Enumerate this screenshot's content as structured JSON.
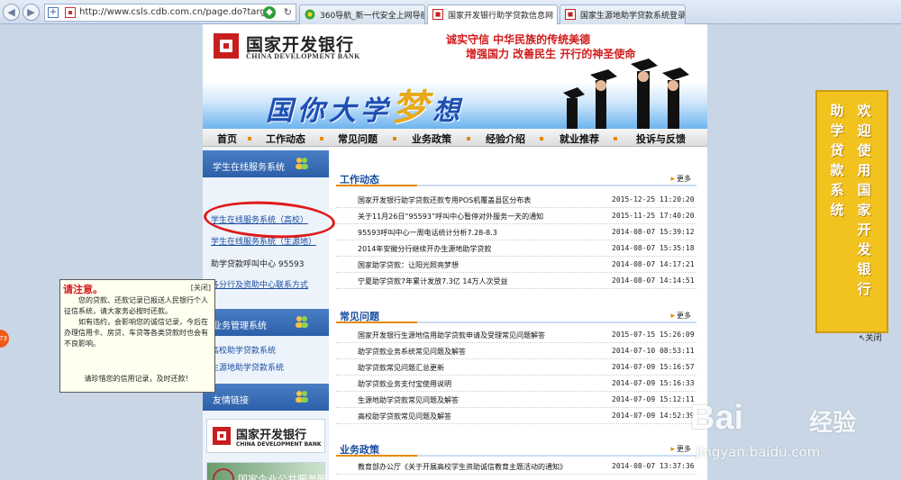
{
  "browser": {
    "url": "http://www.csls.cdb.com.cn/page.do?target",
    "tabs": [
      {
        "label": "360导航_新一代安全上网导航",
        "active": false
      },
      {
        "label": "国家开发银行助学贷款信息网",
        "active": true
      },
      {
        "label": "国家生源地助学贷款系统登录…",
        "active": false
      }
    ]
  },
  "header": {
    "bank_name_cn": "国家开发银行",
    "bank_name_en": "CHINA DEVELOPMENT BANK",
    "slogan_line1": "诚实守信  中华民族的传统美德",
    "slogan_line2": "增强国力  改善民生  开行的神圣使命",
    "banner_text_a": "国你大学",
    "banner_text_big": "梦",
    "banner_text_b": "想"
  },
  "nav": [
    "首页",
    "工作动态",
    "常见问题",
    "业务政策",
    "经验介绍",
    "就业推荐",
    "投诉与反馈"
  ],
  "sidebar": {
    "section1_title": "学生在线服务系统",
    "link_college": "学生在线服务系统（高校）",
    "link_origin": "学生在线服务系统（生源地）",
    "hotline": "助学贷款呼叫中心 95593",
    "contacts": "各分行及资助中心联系方式",
    "section2_title": "业务管理系统",
    "link_mgmt_college": "高校助学贷款系统",
    "link_mgmt_origin": "生源地助学贷款系统",
    "section3_title": "友情链接",
    "friend_bank_cn": "国家开发银行",
    "friend_bank_en": "CHINA DEVELOPMENT BANK",
    "friend_green": "国家企业公共服务网"
  },
  "sections": [
    {
      "title": "工作动态",
      "more": "更多",
      "rows": [
        {
          "title": "国家开发银行助学贷款还款专用POS机覆盖县区分布表",
          "date": "2015-12-25 11:20:20"
        },
        {
          "title": "关于11月26日“95593”呼叫中心暂停对外服务一天的通知",
          "date": "2015-11-25 17:40:20"
        },
        {
          "title": "95593呼叫中心一周电话统计分析7.28-8.3",
          "date": "2014-08-07 15:39:12"
        },
        {
          "title": "2014年安徽分行继续开办生源地助学贷款",
          "date": "2014-08-07 15:35:18"
        },
        {
          "title": "国家助学贷款：让阳光照亮梦想",
          "date": "2014-08-07 14:17:21"
        },
        {
          "title": "宁夏助学贷款7年累计发放7.3亿 14万人次受益",
          "date": "2014-08-07 14:14:51"
        }
      ]
    },
    {
      "title": "常见问题",
      "more": "更多",
      "rows": [
        {
          "title": "国家开发银行生源地信用助学贷款申请及受理常见问题解答",
          "date": "2015-07-15 15:26:09"
        },
        {
          "title": "助学贷款业务系统常见问题及解答",
          "date": "2014-07-10 08:53:11"
        },
        {
          "title": "助学贷款常见问题汇总更新",
          "date": "2014-07-09 15:16:57"
        },
        {
          "title": "助学贷款业务支付宝使用说明",
          "date": "2014-07-09 15:16:33"
        },
        {
          "title": "生源地助学贷款常见问题及解答",
          "date": "2014-07-09 15:12:11"
        },
        {
          "title": "高校助学贷款常见问题及解答",
          "date": "2014-07-09 14:52:39"
        }
      ]
    },
    {
      "title": "业务政策",
      "more": "更多",
      "rows": [
        {
          "title": "教育部办公厅《关于开展高校学生资助诚信教育主题活动的通知》",
          "date": "2014-08-07 13:37:36"
        }
      ]
    }
  ],
  "notice": {
    "title": "请注意。",
    "close": "[关闭]",
    "para1": "您的贷款、还款记录已报送人民银行个人征信系统，请大家务必按时还款。",
    "para2": "如有违约，会影响您的诚信记录，今后在办理信用卡、房贷、车贷等各类贷款时也会有不良影响。",
    "footer": "请珍惜您的信用记录，及时还款！"
  },
  "right_banner": {
    "col1": "欢迎使用国家开发银行",
    "col2": "助学贷款系统",
    "close": "关闭"
  },
  "watermark": {
    "brand": "Bai",
    "brand_cn": "经验",
    "url": "jingyan.baidu.com"
  },
  "colors": {
    "accent_blue": "#1a4da0",
    "accent_orange": "#e68a00",
    "brand_red": "#c81e1e",
    "banner_yellow": "#f2c21e"
  }
}
